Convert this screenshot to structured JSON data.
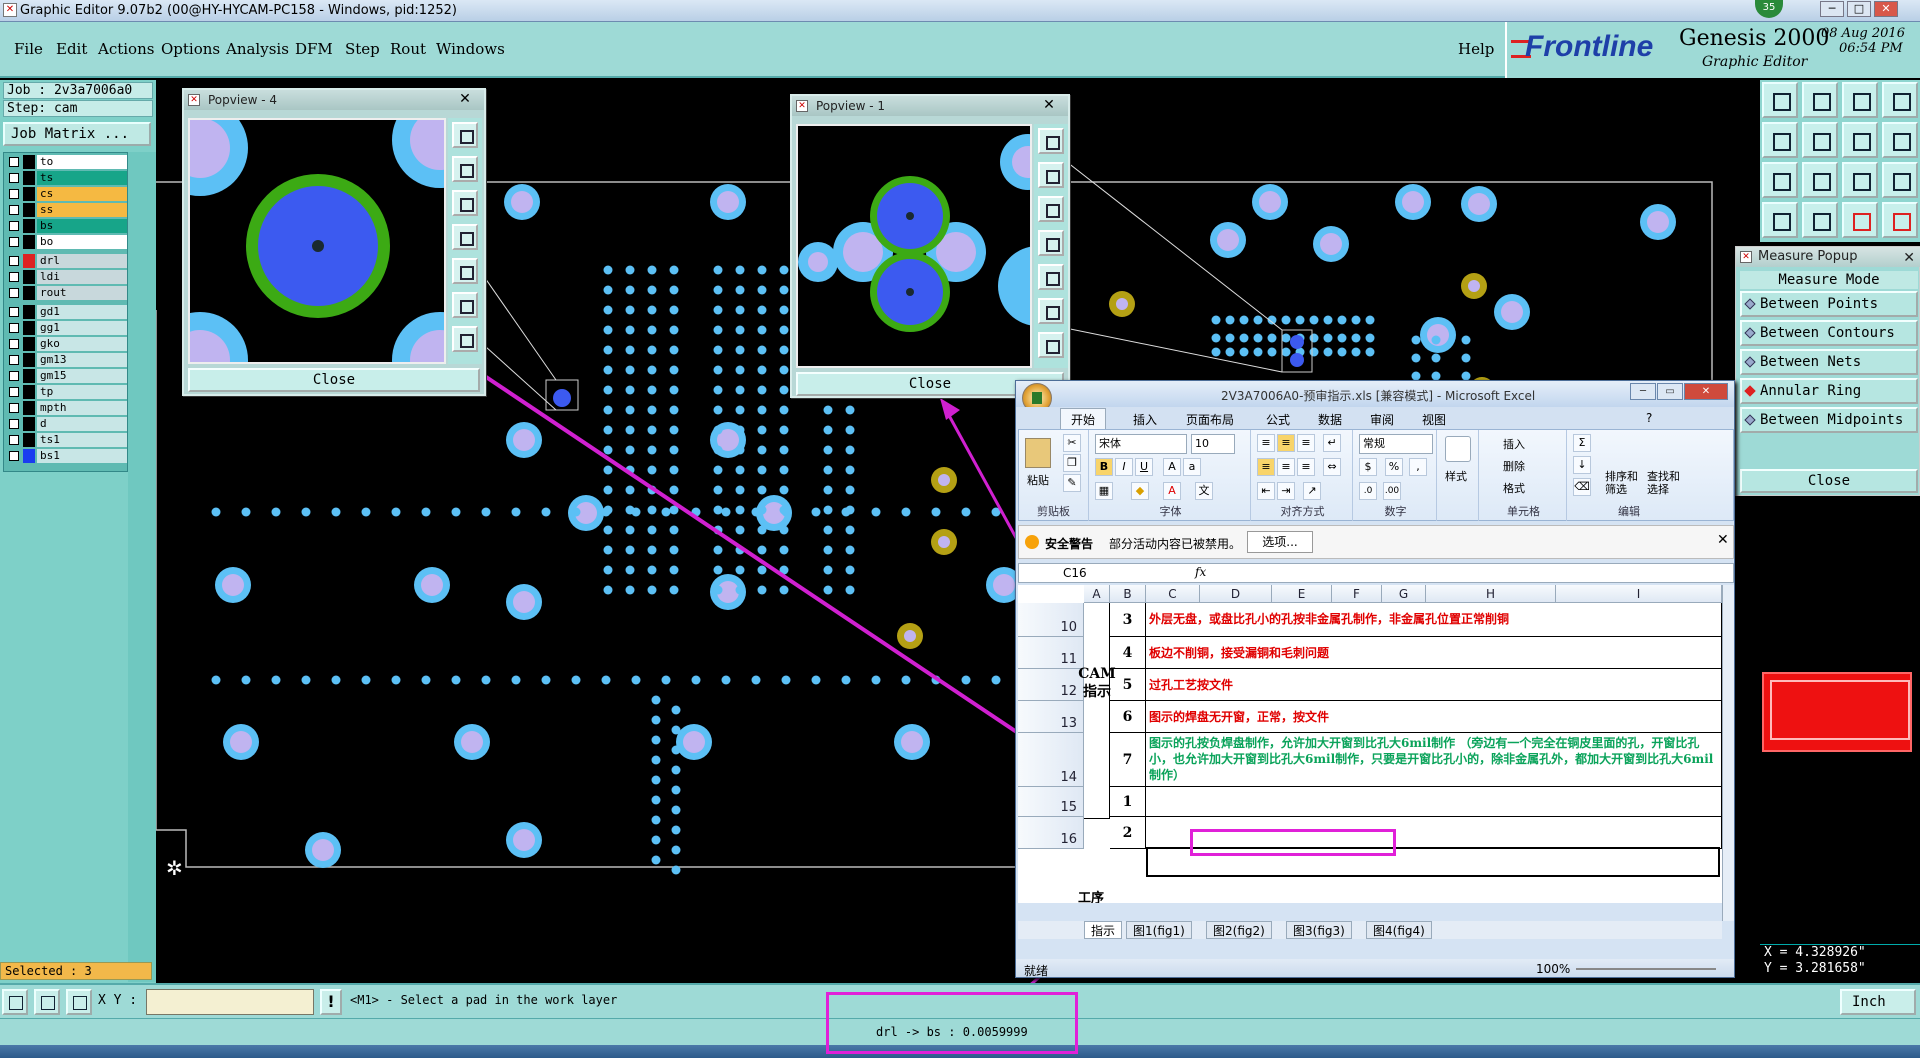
{
  "titlebar": {
    "title": "Graphic Editor 9.07b2 (00@HY-HYCAM-PC158 - Windows, pid:1252)",
    "badge": "35"
  },
  "menu": [
    "File",
    "Edit",
    "Actions",
    "Options",
    "Analysis",
    "DFM",
    "Step",
    "Rout",
    "Windows"
  ],
  "help": "Help",
  "logo": {
    "brand": "Frontline",
    "product": "Genesis 2000",
    "sub": "Graphic Editor",
    "date": "08 Aug 2016",
    "time": "06:54 PM"
  },
  "job": {
    "job_line": "Job : 2v3a7006a0",
    "step_line": "Step: cam",
    "matrix_button": "Job Matrix ..."
  },
  "layers": [
    {
      "name": "to",
      "color": "#ffffff"
    },
    {
      "name": "ts",
      "color": "#17a589"
    },
    {
      "name": "cs",
      "color": "#f5b942"
    },
    {
      "name": "ss",
      "color": "#f5b942"
    },
    {
      "name": "bs",
      "color": "#17a589"
    },
    {
      "name": "bo",
      "color": "#ffffff"
    },
    {
      "name": "drl",
      "color": "#c8d8dc"
    },
    {
      "name": "ldi",
      "color": "#c8d8dc"
    },
    {
      "name": "rout",
      "color": "#c8d8dc"
    },
    {
      "name": "gd1",
      "color": "#c8e6e6"
    },
    {
      "name": "gg1",
      "color": "#c8e6e6"
    },
    {
      "name": "gko",
      "color": "#c8e6e6"
    },
    {
      "name": "gm13",
      "color": "#c8e6e6"
    },
    {
      "name": "gm15",
      "color": "#c8e6e6"
    },
    {
      "name": "tp",
      "color": "#c8e6e6"
    },
    {
      "name": "mpth",
      "color": "#c8e6e6"
    },
    {
      "name": "d",
      "color": "#c8e6e6"
    },
    {
      "name": "ts1",
      "color": "#c8e6e6"
    },
    {
      "name": "bs1",
      "color": "#c8e6e6"
    }
  ],
  "selected": "Selected : 3",
  "popview4": {
    "title": "Popview - 4",
    "close": "Close"
  },
  "popview1": {
    "title": "Popview - 1",
    "close": "Close"
  },
  "measure": {
    "title": "Measure Popup",
    "mode_label": "Measure Mode",
    "options": [
      "Between Points",
      "Between Contours",
      "Between Nets",
      "Annular Ring",
      "Between Midpoints"
    ],
    "active_option": "Annular Ring",
    "close": "Close"
  },
  "coords": {
    "x": "X = 4.328926\"",
    "y": "Y = 3.281658\""
  },
  "excel": {
    "title": "2V3A7006A0-预审指示.xls  [兼容模式]  -  Microsoft Excel",
    "tabs": [
      "开始",
      "插入",
      "页面布局",
      "公式",
      "数据",
      "审阅",
      "视图"
    ],
    "paste": "粘贴",
    "font_name": "宋体",
    "font_size": "10",
    "number_format": "常规",
    "style": "样式",
    "insert": "插入",
    "delete": "删除",
    "format": "格式",
    "sort": "排序和筛选",
    "find": "查找和选择",
    "groups": [
      "剪贴板",
      "字体",
      "对齐方式",
      "数字",
      "单元格",
      "编辑"
    ],
    "security_warning": "安全警告",
    "security_text": "部分活动内容已被禁用。",
    "options_button": "选项...",
    "namebox": "C16",
    "fx": "fx",
    "columns": [
      "A",
      "B",
      "C",
      "D",
      "E",
      "F",
      "G",
      "H",
      "I"
    ],
    "rows": [
      {
        "row": "10",
        "num": "3",
        "text": "外层无盘，或盘比孔小的孔按非金属孔制作，非金属孔位置正常削铜",
        "color": "#e00000"
      },
      {
        "row": "11",
        "num": "4",
        "text": "板边不削铜，接受漏铜和毛刺问题",
        "color": "#e00000"
      },
      {
        "row": "12",
        "num": "5",
        "text": "过孔工艺按文件",
        "color": "#e00000"
      },
      {
        "row": "13",
        "num": "6",
        "text": "图示的焊盘无开窗，正常，按文件",
        "color": "#e00000"
      },
      {
        "row": "14",
        "num": "7",
        "text": "图示的孔按负焊盘制作，允许加大开窗到比孔大6mil制作 （旁边有一个完全在铜皮里面的孔，开窗比孔小，也允许加大开窗到比孔大6mil制作，只要是开窗比孔小的，除非金属孔外，都加大开窗到比孔大6mil制作）",
        "color": "#0aa35a"
      },
      {
        "row": "15",
        "num": "1",
        "text": "",
        "color": "#000"
      },
      {
        "row": "16",
        "num": "2",
        "text": "",
        "color": "#000"
      }
    ],
    "group_label": "CAM\n指示",
    "group_label2": "工序",
    "sheets": [
      "指示",
      "图1(fig1)",
      "图2(fig2)",
      "图3(fig3)",
      "图4(fig4)"
    ],
    "status_ready": "就绪",
    "zoom": "100%"
  },
  "cmdbar": {
    "xy_label": "X Y :",
    "prompt": "<M1> - Select a pad in the work layer",
    "units": "Inch"
  },
  "status_measure": "drl -> bs : 0.0059999",
  "colors": {
    "pad_light": "#5cc0f5",
    "pad_inner": "#c0b4f0",
    "drill_blue": "#3c5af0",
    "ring_green": "#3caa14",
    "gold": "#b4a014",
    "magenta": "#d020d0"
  }
}
